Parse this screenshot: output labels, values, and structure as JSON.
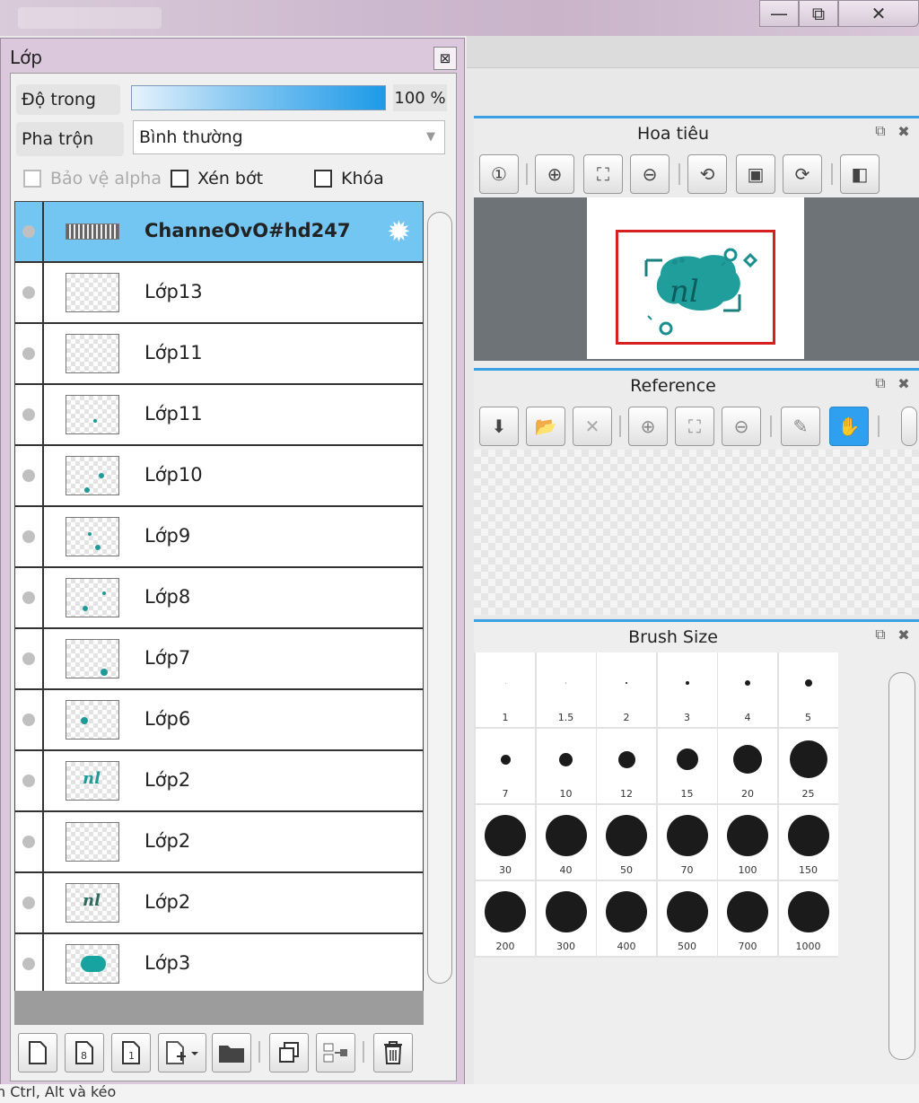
{
  "window": {
    "minimize": "—",
    "restore": "⧉",
    "close": "✕"
  },
  "status": {
    "text": "n Ctrl, Alt và kéo"
  },
  "layer_panel": {
    "title": "Lớp",
    "close": "⊠",
    "opacity_label": "Độ trong",
    "opacity_value": "100 %",
    "opacity_percent": 100,
    "blend_label": "Pha trộn",
    "blend_value": "Bình thường",
    "protect_alpha": "Bảo vệ alpha",
    "clipping": "Xén bớt",
    "lock": "Khóa",
    "layers": [
      {
        "name": "ChanneOvO#hd247",
        "selected": true
      },
      {
        "name": "Lớp13"
      },
      {
        "name": "Lớp11"
      },
      {
        "name": "Lớp11"
      },
      {
        "name": "Lớp10"
      },
      {
        "name": "Lớp9"
      },
      {
        "name": "Lớp8"
      },
      {
        "name": "Lớp7"
      },
      {
        "name": "Lớp6"
      },
      {
        "name": "Lớp2"
      },
      {
        "name": "Lớp2"
      },
      {
        "name": "Lớp2"
      },
      {
        "name": "Lớp3"
      }
    ],
    "toolbar_icons": [
      "new-layer-icon",
      "new-8bit-layer-icon",
      "new-1bit-layer-icon",
      "add-layer-menu-icon",
      "new-folder-icon",
      "duplicate-layer-icon",
      "merge-down-icon",
      "delete-layer-icon"
    ]
  },
  "navigator": {
    "title": "Hoa tiêu",
    "icons": [
      "zoom-reset-icon",
      "zoom-in-icon",
      "fit-icon",
      "zoom-out-icon",
      "rotate-left-icon",
      "reset-rotation-icon",
      "rotate-right-icon",
      "flip-horizontal-icon"
    ]
  },
  "reference": {
    "title": "Reference",
    "icons": [
      "load-icon",
      "open-folder-icon",
      "close-icon",
      "zoom-in-icon",
      "fit-icon",
      "zoom-out-icon",
      "eyedropper-icon",
      "hand-icon"
    ]
  },
  "brush_size": {
    "title": "Brush Size",
    "sizes": [
      "1",
      "1.5",
      "2",
      "3",
      "4",
      "5",
      "7",
      "10",
      "12",
      "15",
      "20",
      "25",
      "30",
      "40",
      "50",
      "70",
      "100",
      "150",
      "200",
      "300",
      "400",
      "500",
      "700",
      "1000"
    ]
  }
}
